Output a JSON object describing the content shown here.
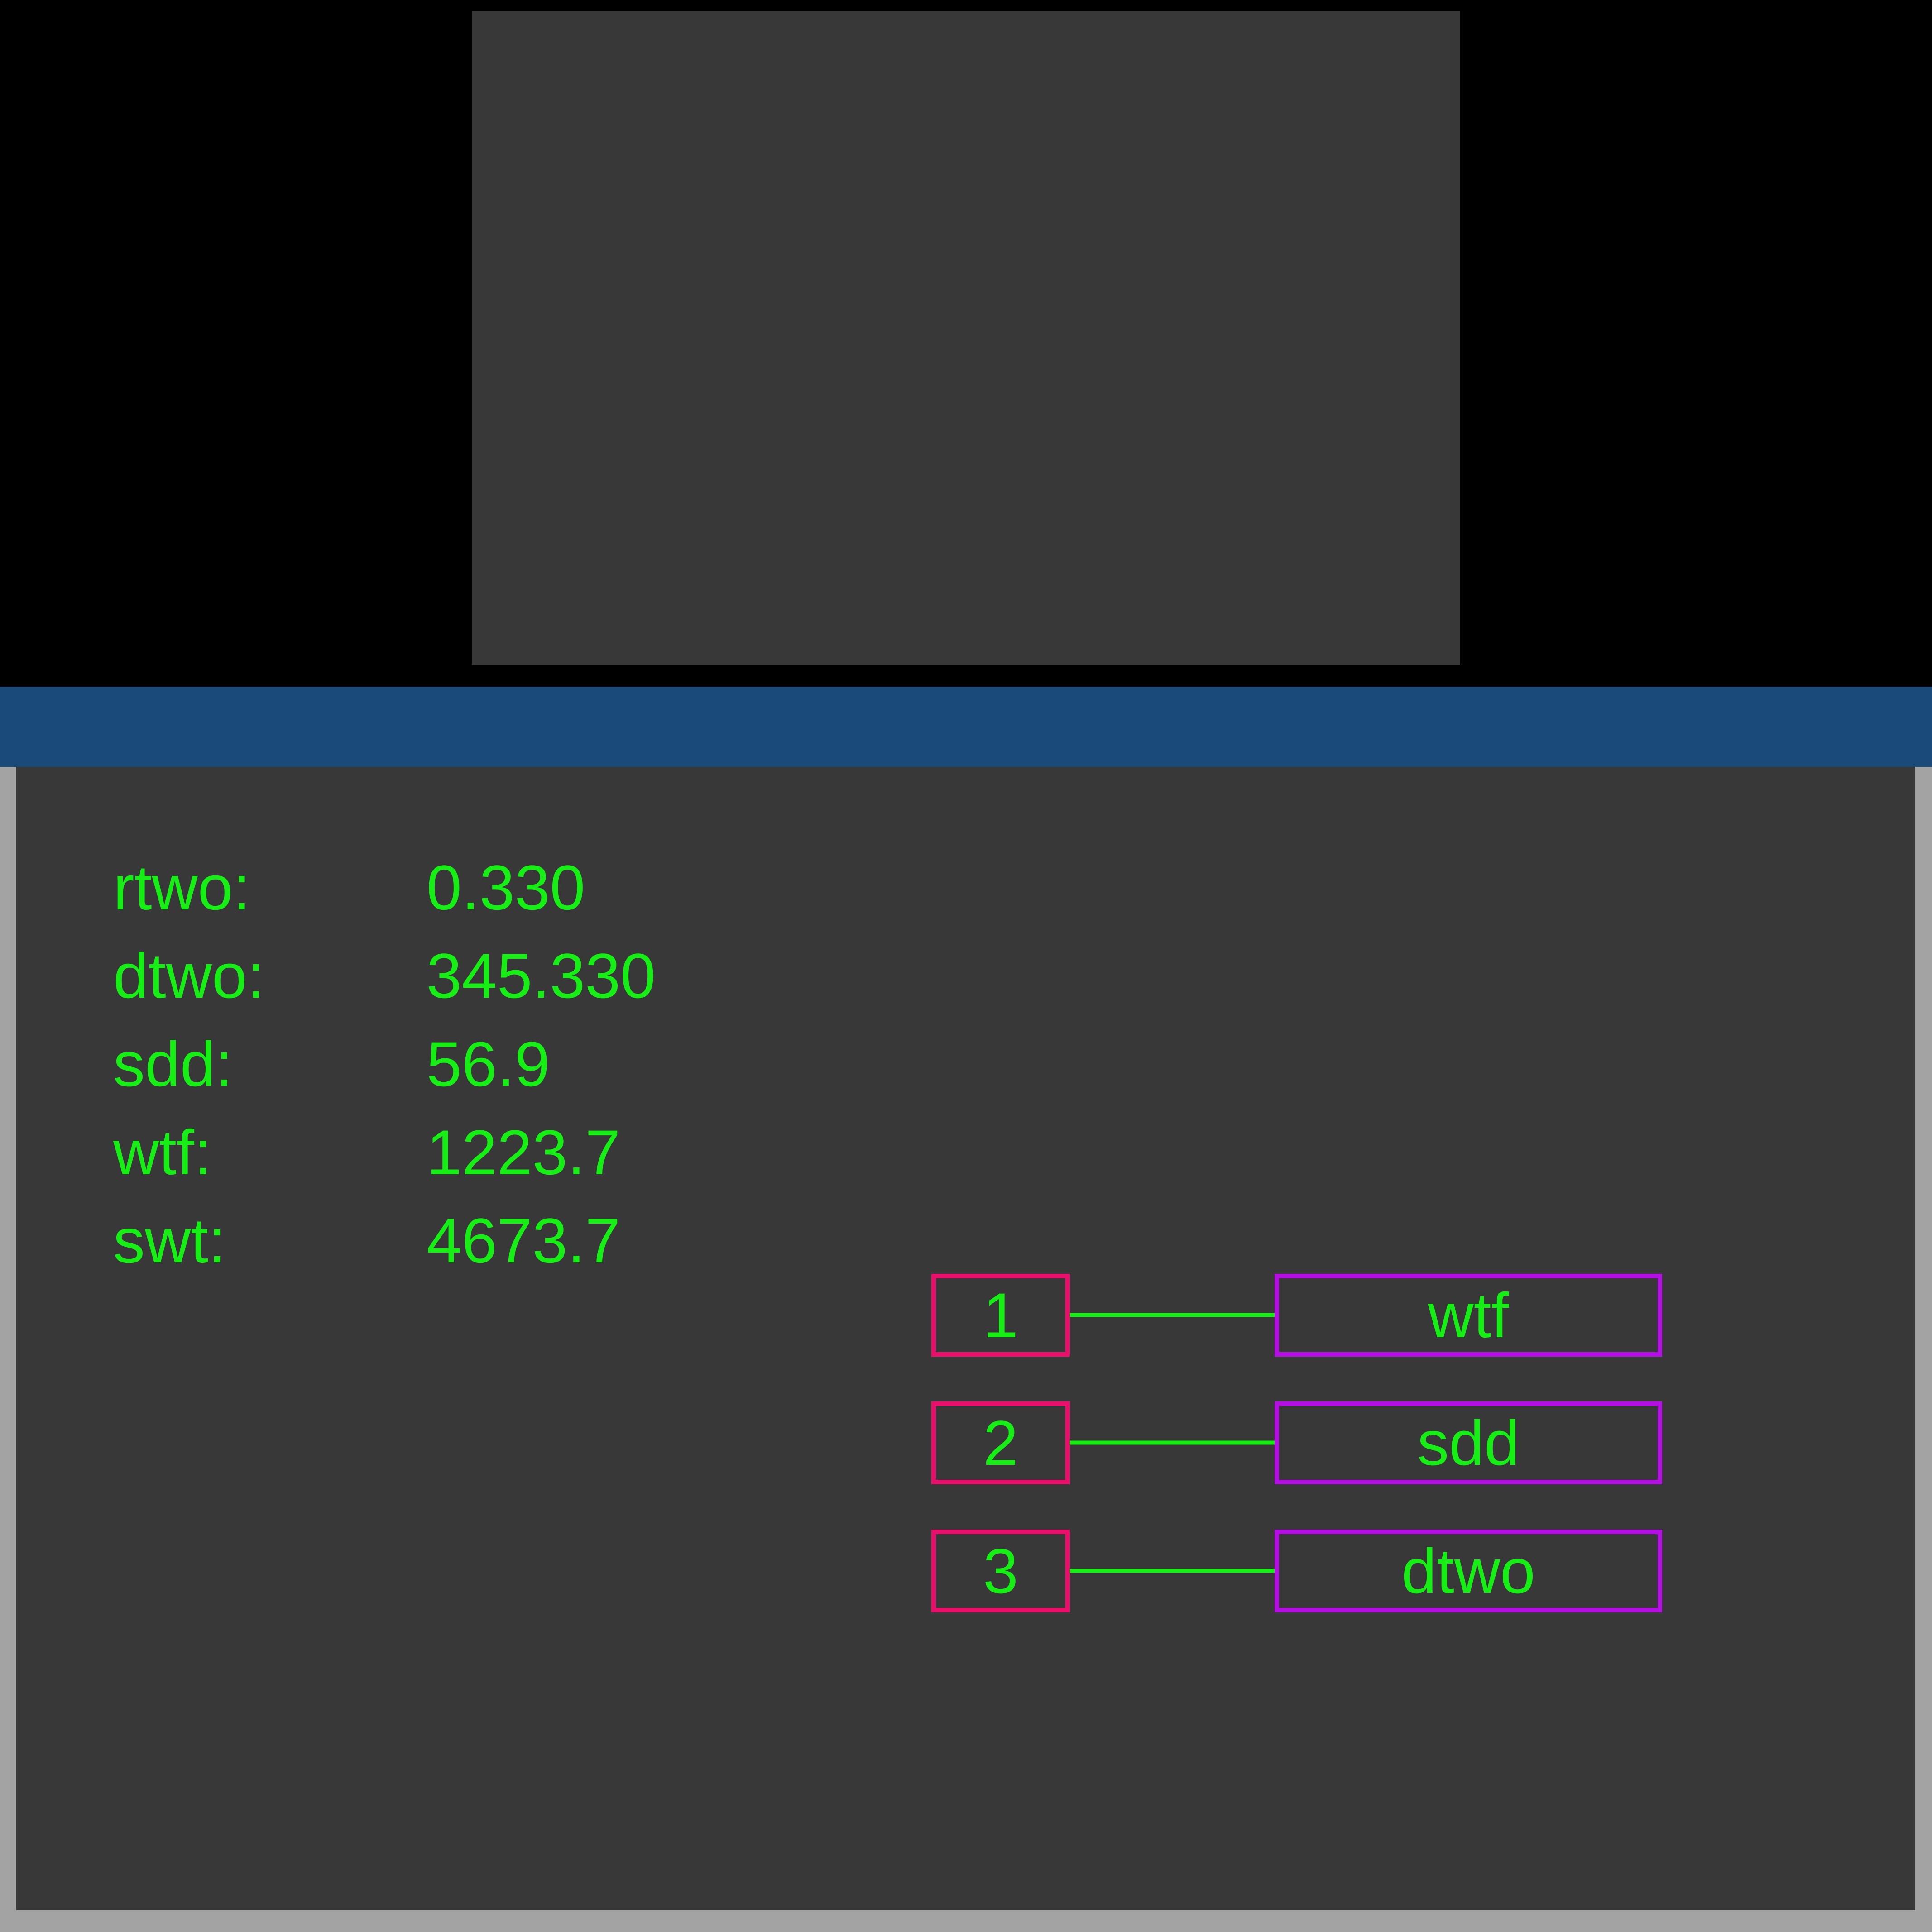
{
  "colors": {
    "background": "#000000",
    "panel": "#383838",
    "title_bar": "#1a4a7a",
    "frame": "#a3a3a3",
    "text": "#16ee16",
    "index_border": "#e8106a",
    "name_border": "#b30fe0",
    "connector": "#16ee16"
  },
  "readouts": [
    {
      "label": "rtwo:",
      "value": "0.330"
    },
    {
      "label": "dtwo:",
      "value": "345.330"
    },
    {
      "label": "sdd:",
      "value": "56.9"
    },
    {
      "label": "wtf:",
      "value": "1223.7"
    },
    {
      "label": "swt:",
      "value": "4673.7"
    }
  ],
  "mappings": [
    {
      "index": "1",
      "name": "wtf"
    },
    {
      "index": "2",
      "name": "sdd"
    },
    {
      "index": "3",
      "name": "dtwo"
    }
  ]
}
